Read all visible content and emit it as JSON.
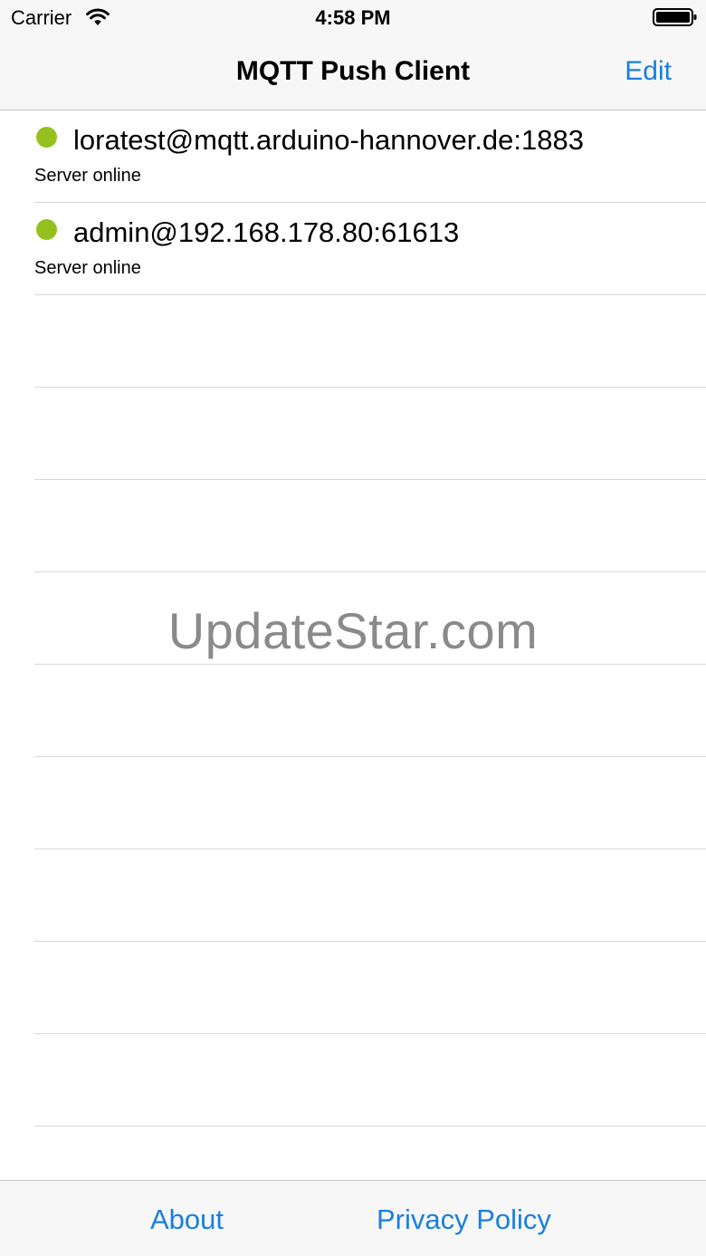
{
  "status_bar": {
    "carrier": "Carrier",
    "time": "4:58 PM",
    "wifi_icon": "wifi-icon",
    "battery_icon": "battery-icon"
  },
  "nav_bar": {
    "title": "MQTT Push Client",
    "edit_label": "Edit"
  },
  "servers": [
    {
      "name": "loratest@mqtt.arduino-hannover.de:1883",
      "status": "Server online",
      "status_color": "#95c11f"
    },
    {
      "name": "admin@192.168.178.80:61613",
      "status": "Server online",
      "status_color": "#95c11f"
    }
  ],
  "watermark": "UpdateStar.com",
  "toolbar": {
    "about_label": "About",
    "privacy_label": "Privacy Policy"
  },
  "colors": {
    "accent": "#1a7fe0",
    "online": "#95c11f",
    "bar_background": "#f7f7f7"
  }
}
